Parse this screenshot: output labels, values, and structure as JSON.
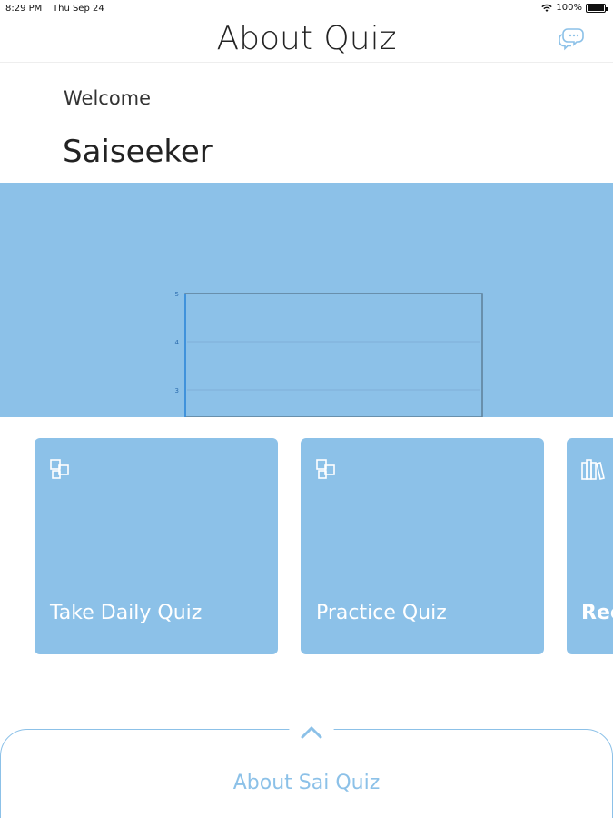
{
  "status_bar": {
    "time": "8:29 PM",
    "date": "Thu Sep 24",
    "battery": "100%",
    "battery_level": 1.0
  },
  "header": {
    "title": "About Quiz",
    "action_icon": "chat-bubbles-icon"
  },
  "greeting": {
    "welcome": "Welcome",
    "username": "Saiseeker"
  },
  "chart_data": {
    "type": "line",
    "y_ticks": [
      "5",
      "4",
      "3"
    ],
    "series": []
  },
  "cards": [
    {
      "label": "Take Daily Quiz",
      "icon": "quiz-tiles-icon"
    },
    {
      "label": "Practice Quiz",
      "icon": "quiz-tiles-icon"
    },
    {
      "label": "Rec",
      "icon": "books-icon"
    }
  ],
  "drawer": {
    "label": "About Sai Quiz",
    "icon": "chevron-up-icon"
  },
  "colors": {
    "accent": "#8cc1e8",
    "card_text": "#ffffff"
  }
}
